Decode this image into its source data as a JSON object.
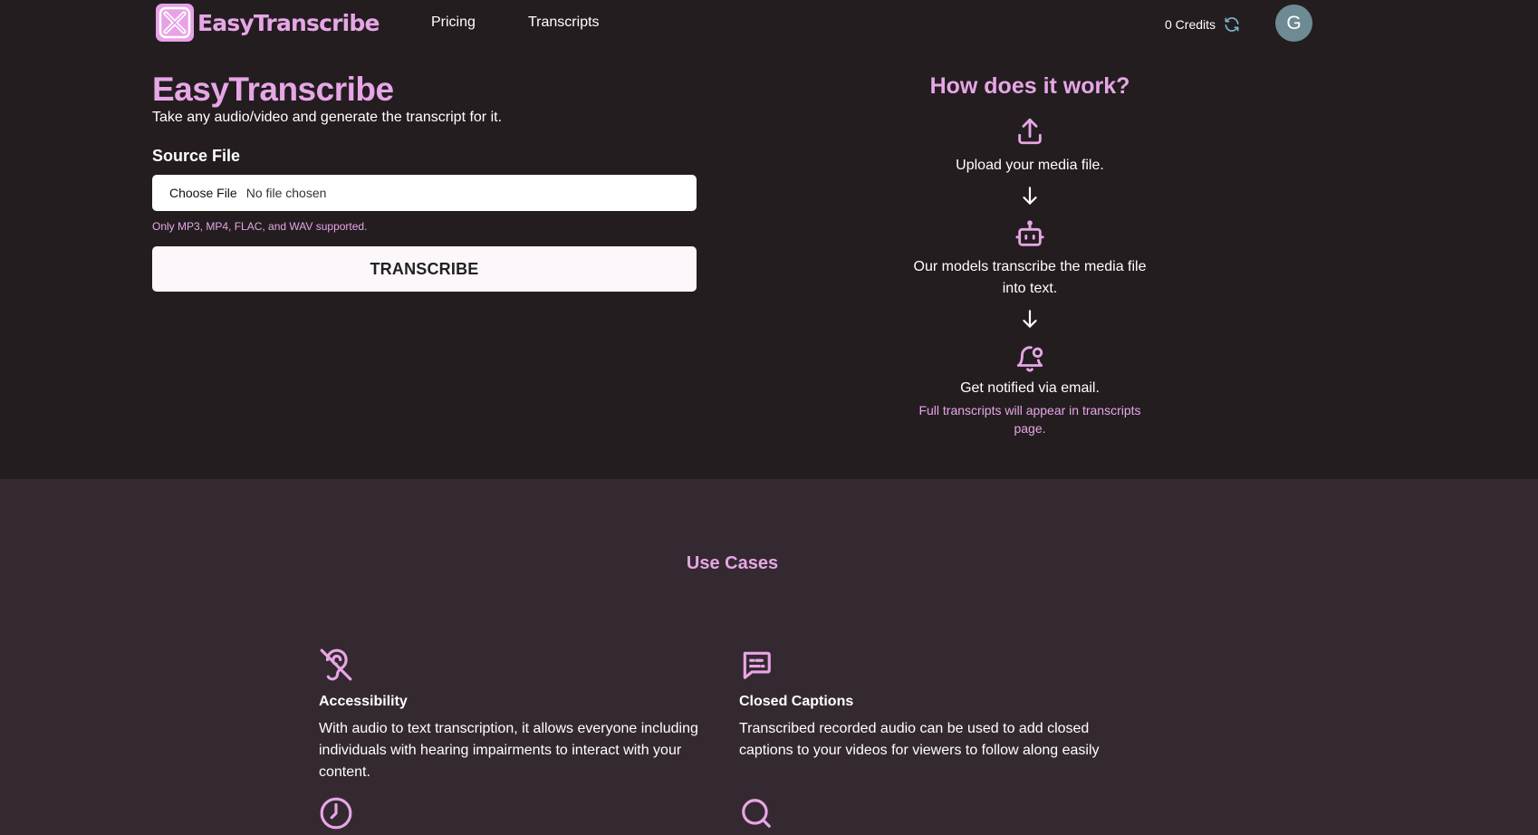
{
  "nav": {
    "brand": "EasyTranscribe",
    "links": [
      {
        "label": "Pricing"
      },
      {
        "label": "Transcripts"
      }
    ],
    "credits": "0 Credits",
    "avatar_initial": "G"
  },
  "main": {
    "title": "EasyTranscribe",
    "subtitle": "Take any audio/video and generate the transcript for it.",
    "source_label": "Source File",
    "file_button": "Choose File",
    "file_status": "No file chosen",
    "help_text": "Only MP3, MP4, FLAC, and WAV supported.",
    "transcribe_button": "TRANSCRIBE"
  },
  "how": {
    "title": "How does it work?",
    "step1": "Upload your media file.",
    "step2": "Our models transcribe the media file into text.",
    "step3": "Get notified via email.",
    "step3_note": "Full transcripts will appear in transcripts page."
  },
  "usecases": {
    "title": "Use Cases",
    "items": [
      {
        "name": "Accessibility",
        "desc": "With audio to text transcription, it allows everyone including individuals with hearing impairments to interact with your content.",
        "icon": "ear-off-icon"
      },
      {
        "name": "Closed Captions",
        "desc": "Transcribed recorded audio can be used to add closed captions to your videos for viewers to follow along easily",
        "icon": "message-text-icon"
      },
      {
        "name": "",
        "desc": "",
        "icon": "clock-icon"
      },
      {
        "name": "",
        "desc": "",
        "icon": "search-icon"
      }
    ]
  },
  "colors": {
    "background": "#231d20",
    "section_background": "#342930",
    "accent": "#e7a6e6"
  }
}
